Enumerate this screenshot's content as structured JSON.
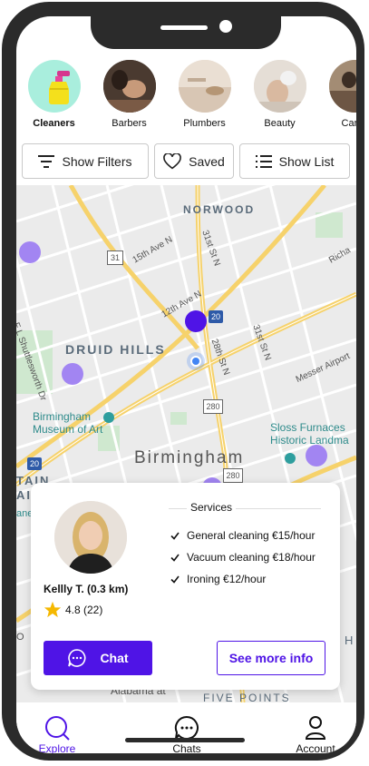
{
  "categories": [
    {
      "label": "Cleaners",
      "icon": "spray-bottle-icon",
      "active": true
    },
    {
      "label": "Barbers",
      "icon": "barber-photo"
    },
    {
      "label": "Plumbers",
      "icon": "plumber-photo"
    },
    {
      "label": "Beauty",
      "icon": "beauty-photo"
    },
    {
      "label": "Carpe",
      "icon": "carpenter-photo"
    }
  ],
  "filters": {
    "show_filters": "Show Filters",
    "saved": "Saved",
    "show_list": "Show List"
  },
  "map": {
    "labels": {
      "norwood": "NORWOOD",
      "druid_hills": "DRUID HILLS",
      "birmingham": "Birmingham",
      "museum": "Birmingham\nMuseum of Art",
      "sloss": "Sloss Furnaces\nHistoric Landma",
      "street_15th": "15th Ave N",
      "street_12th": "12th Ave N",
      "street_31st": "31st St N",
      "street_28th": "28th St N",
      "street_31st_b": "31st St N",
      "street_messer": "Messer Airport",
      "street_shuttle": "F L Shuttlesworth Dr",
      "richard": "Richa",
      "tain": "TAIN",
      "ain": "AIN",
      "lane": "ane",
      "five_points": "FIVE POINTS",
      "alabama": "Alabama at",
      "h": "H",
      "o": "O",
      "shield_31": "31",
      "shield_20": "20",
      "shield_280": "280",
      "shield_20b": "20",
      "shield_280b": "280"
    },
    "colors": {
      "pin": "#8f6ef0",
      "pin_selected": "#4f14e6",
      "location": "#4285f4"
    }
  },
  "card": {
    "provider_name": "Kellly T. (0.3 km)",
    "rating": "4.8 (22)",
    "services_title": "Services",
    "services": [
      "General cleaning €15/hour",
      "Vacuum cleaning €18/hour",
      "Ironing €12/hour"
    ],
    "chat_label": "Chat",
    "more_label": "See more info"
  },
  "tabs": {
    "explore": "Explore",
    "chats": "Chats",
    "account": "Account"
  },
  "accent": "#4f14e6"
}
